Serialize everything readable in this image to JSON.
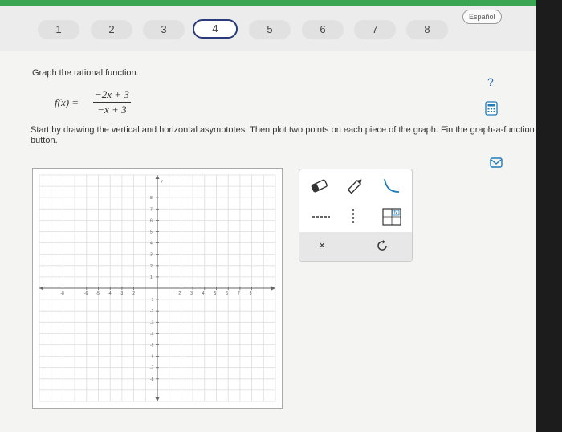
{
  "progress": {
    "steps": [
      "1",
      "2",
      "3",
      "4",
      "5",
      "6",
      "7",
      "8"
    ],
    "active_index": 3
  },
  "language_button": "Español",
  "problem": {
    "instruction": "Graph the rational function.",
    "function_name": "f(x) =",
    "numerator": "−2x + 3",
    "denominator": "−x + 3",
    "directions": "Start by drawing the vertical and horizontal asymptotes. Then plot two points on each piece of the graph. Fin the graph-a-function button."
  },
  "graph": {
    "x_range": [
      -10,
      10
    ],
    "y_range": [
      -10,
      10
    ],
    "x_labels": [
      "-8",
      "-6",
      "-5",
      "-4",
      "-3",
      "-2",
      "2",
      "3",
      "4",
      "5",
      "6",
      "7",
      "8"
    ],
    "y_labels": [
      "8",
      "7",
      "6",
      "5",
      "4",
      "3",
      "2",
      "1",
      "-1",
      "-2",
      "-3",
      "-4",
      "-5",
      "-6",
      "-7",
      "-8"
    ],
    "y_axis_label": "y"
  },
  "tools": {
    "icons": [
      "eraser-icon",
      "pencil-icon",
      "curve-icon",
      "horizontal-dashed-icon",
      "vertical-dashed-icon",
      "graph-function-icon"
    ],
    "undo_label": "×"
  },
  "colors": {
    "accent": "#2b3a7a",
    "progress_green": "#3aa553",
    "tool_blue": "#1f7ab8"
  }
}
